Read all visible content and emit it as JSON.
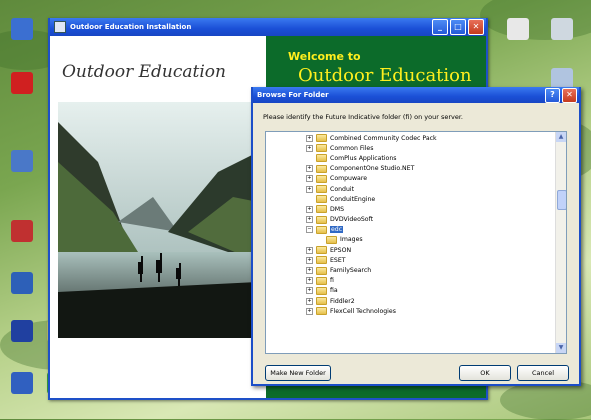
{
  "desktop": {
    "icons": [
      {
        "label": "",
        "color": "#3b6fd1"
      },
      {
        "label": "",
        "color": "#d02020"
      },
      {
        "label": "",
        "color": "#4a78c8"
      },
      {
        "label": "",
        "color": "#c03030"
      },
      {
        "label": "",
        "color": "#2d60b8"
      },
      {
        "label": "",
        "color": "#2040a0"
      },
      {
        "label": "",
        "color": "#6a9ad8"
      },
      {
        "label": "",
        "color": "#cfd8e0"
      },
      {
        "label": "",
        "color": "#e8e8e8"
      },
      {
        "label": "",
        "color": "#b0c4e0"
      }
    ]
  },
  "installer": {
    "title": "Outdoor Education Installation",
    "brand": "Outdoor Education",
    "welcome": "Welcome to",
    "welcome_product": "Outdoor Education"
  },
  "browse": {
    "title": "Browse For Folder",
    "help_symbol": "?",
    "close_symbol": "✕",
    "prompt": "Please identify the Future Indicative folder (fi) on your server.",
    "tree": [
      {
        "label": "Combined Community Codec Pack",
        "expand": "+",
        "indent": 0,
        "selected": false
      },
      {
        "label": "Common Files",
        "expand": "+",
        "indent": 0,
        "selected": false
      },
      {
        "label": "ComPlus Applications",
        "expand": "",
        "indent": 0,
        "selected": false
      },
      {
        "label": "ComponentOne Studio.NET",
        "expand": "+",
        "indent": 0,
        "selected": false
      },
      {
        "label": "Compuware",
        "expand": "+",
        "indent": 0,
        "selected": false
      },
      {
        "label": "Conduit",
        "expand": "+",
        "indent": 0,
        "selected": false
      },
      {
        "label": "ConduitEngine",
        "expand": "",
        "indent": 0,
        "selected": false
      },
      {
        "label": "DMS",
        "expand": "+",
        "indent": 0,
        "selected": false
      },
      {
        "label": "DVDVideoSoft",
        "expand": "+",
        "indent": 0,
        "selected": false
      },
      {
        "label": "edc",
        "expand": "−",
        "indent": 0,
        "selected": true
      },
      {
        "label": "Images",
        "expand": "",
        "indent": 1,
        "selected": false
      },
      {
        "label": "EPSON",
        "expand": "+",
        "indent": 0,
        "selected": false
      },
      {
        "label": "ESET",
        "expand": "+",
        "indent": 0,
        "selected": false
      },
      {
        "label": "FamilySearch",
        "expand": "+",
        "indent": 0,
        "selected": false
      },
      {
        "label": "fi",
        "expand": "+",
        "indent": 0,
        "selected": false
      },
      {
        "label": "fia",
        "expand": "+",
        "indent": 0,
        "selected": false
      },
      {
        "label": "Fiddler2",
        "expand": "+",
        "indent": 0,
        "selected": false
      },
      {
        "label": "FlexCell Technologies",
        "expand": "+",
        "indent": 0,
        "selected": false
      }
    ],
    "scroll_up": "▲",
    "scroll_down": "▼",
    "make_new_folder": "Make New Folder",
    "ok": "OK",
    "cancel": "Cancel"
  }
}
